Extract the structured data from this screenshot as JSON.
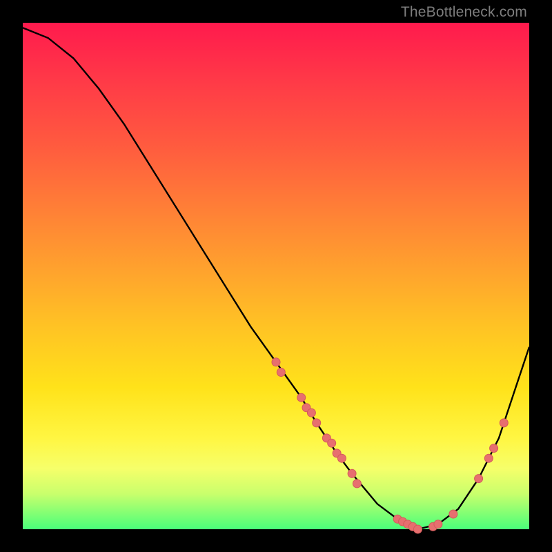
{
  "watermark": "TheBottleneck.com",
  "chart_data": {
    "type": "line",
    "title": "",
    "xlabel": "",
    "ylabel": "",
    "xlim": [
      0,
      100
    ],
    "ylim": [
      0,
      100
    ],
    "series": [
      {
        "name": "bottleneck-curve",
        "x": [
          0,
          5,
          10,
          15,
          20,
          25,
          30,
          35,
          40,
          45,
          50,
          55,
          58,
          62,
          65,
          70,
          74,
          78,
          82,
          86,
          90,
          94,
          97,
          100
        ],
        "y": [
          99,
          97,
          93,
          87,
          80,
          72,
          64,
          56,
          48,
          40,
          33,
          26,
          21,
          15,
          11,
          5,
          2,
          0,
          1,
          4,
          10,
          18,
          27,
          36
        ]
      }
    ],
    "clusters": [
      {
        "name": "cluster-left-upper",
        "points": [
          {
            "x": 50,
            "y": 33
          },
          {
            "x": 51,
            "y": 31
          }
        ]
      },
      {
        "name": "cluster-left-mid",
        "points": [
          {
            "x": 55,
            "y": 26
          },
          {
            "x": 56,
            "y": 24
          },
          {
            "x": 57,
            "y": 23
          },
          {
            "x": 58,
            "y": 21
          }
        ]
      },
      {
        "name": "cluster-left-lower",
        "points": [
          {
            "x": 60,
            "y": 18
          },
          {
            "x": 61,
            "y": 17
          },
          {
            "x": 62,
            "y": 15
          },
          {
            "x": 63,
            "y": 14
          }
        ]
      },
      {
        "name": "cluster-left-bottom",
        "points": [
          {
            "x": 65,
            "y": 11
          },
          {
            "x": 66,
            "y": 9
          }
        ]
      },
      {
        "name": "cluster-bottom",
        "points": [
          {
            "x": 74,
            "y": 2
          },
          {
            "x": 75,
            "y": 1.5
          },
          {
            "x": 76,
            "y": 1
          },
          {
            "x": 77,
            "y": 0.5
          },
          {
            "x": 78,
            "y": 0
          },
          {
            "x": 81,
            "y": 0.5
          },
          {
            "x": 82,
            "y": 1
          },
          {
            "x": 85,
            "y": 3
          }
        ]
      },
      {
        "name": "cluster-right",
        "points": [
          {
            "x": 90,
            "y": 10
          },
          {
            "x": 92,
            "y": 14
          },
          {
            "x": 93,
            "y": 16
          },
          {
            "x": 95,
            "y": 21
          }
        ]
      }
    ],
    "colors": {
      "curve": "#000000",
      "dot_fill": "#e76f6f",
      "dot_stroke": "#d45a5a"
    }
  }
}
